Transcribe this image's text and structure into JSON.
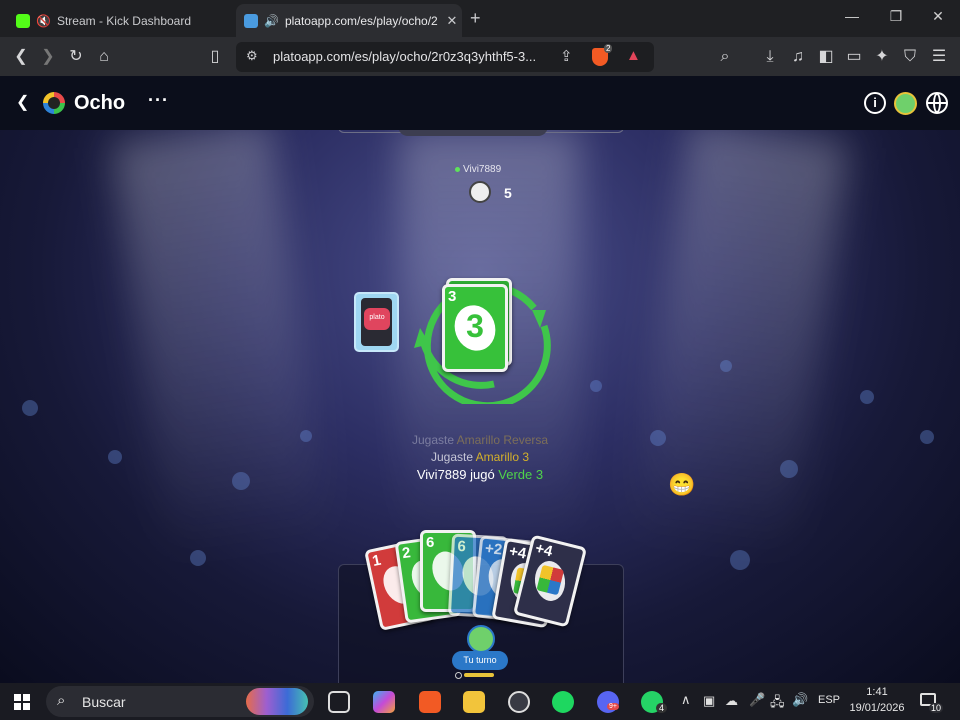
{
  "browser": {
    "tabs": [
      {
        "title": "Stream - Kick Dashboard",
        "active": false,
        "favicon_color": "#53fc18"
      },
      {
        "title": "platoapp.com/es/play/ocho/2",
        "active": true,
        "favicon_color": "#4a9be0"
      }
    ],
    "address": "platoapp.com/es/play/ocho/2r0z3q3yhthf5-3...",
    "shield_badge": "2"
  },
  "page": {
    "title": "Ocho",
    "more": "···"
  },
  "game": {
    "opponent": {
      "name": "Vivi7889",
      "card_count": "5"
    },
    "draw_pile_label": "plato",
    "discard_top": {
      "value": "3",
      "color": "#37c13a"
    },
    "log": [
      {
        "prefix": "Jugaste ",
        "card": "Amarillo Reversa",
        "card_color": "#a9943d",
        "faded": true
      },
      {
        "prefix": "Jugaste ",
        "card": "Amarillo 3",
        "card_color": "#d4b12a",
        "faded": false
      },
      {
        "prefix": "Vivi7889 jugó ",
        "card": "Verde 3",
        "card_color": "#4fd34a",
        "faded": false
      }
    ],
    "hand": [
      {
        "value": "1",
        "color": "#d13b3b"
      },
      {
        "value": "2",
        "color": "#38b83b"
      },
      {
        "value": "6",
        "color": "#38b83b"
      },
      {
        "value": "6",
        "color": "#2b78c8"
      },
      {
        "value": "+2",
        "color": "#2b78c8"
      },
      {
        "value": "+4",
        "color": "#2e2f49"
      },
      {
        "value": "+4",
        "color": "#2e2f49"
      }
    ],
    "turn_label": "Tu turno",
    "emoji": "😁"
  },
  "taskbar": {
    "search_placeholder": "Buscar",
    "language": "ESP",
    "time": "1:41",
    "date": "19/01/2026",
    "notifications": "10",
    "discord_badge": "9+",
    "whatsapp_badge": "4"
  }
}
